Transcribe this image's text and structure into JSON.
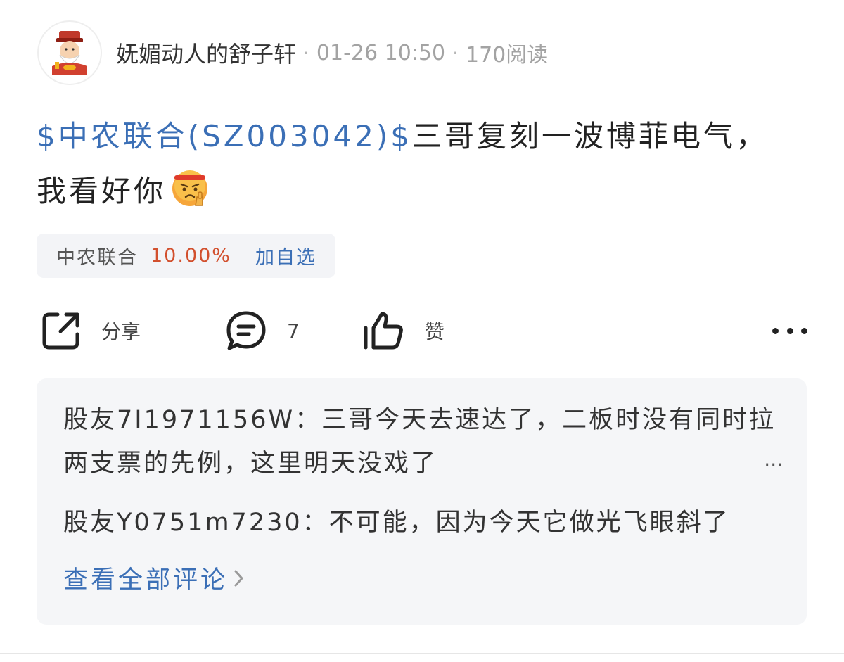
{
  "header": {
    "username": "妩媚动人的舒子轩",
    "separator": "·",
    "time": "01-26 10:50",
    "reads": "170阅读"
  },
  "post": {
    "stock_link": "$中农联合(SZ003042)$",
    "text": "三哥复刻一波博菲电气，我看好你",
    "emoji": "angry-thumbs-up-emoji"
  },
  "stock_card": {
    "name": "中农联合",
    "change": "10.00%",
    "add_label": "加自选"
  },
  "actions": {
    "share_label": "分享",
    "comment_count": "7",
    "like_label": "赞"
  },
  "comments": [
    {
      "author": "股友7I1971156W：",
      "text": "三哥今天去速达了，二板时没有同时拉两支票的先例，这里明天没戏了",
      "ellipsis": "..."
    },
    {
      "author": "股友Y0751m7230：",
      "text": "不可能，因为今天它做光飞眼斜了"
    }
  ],
  "view_all_label": "查看全部评论",
  "colors": {
    "link": "#3b6fb6",
    "up": "#d2502e",
    "panel": "#f5f6f8"
  }
}
